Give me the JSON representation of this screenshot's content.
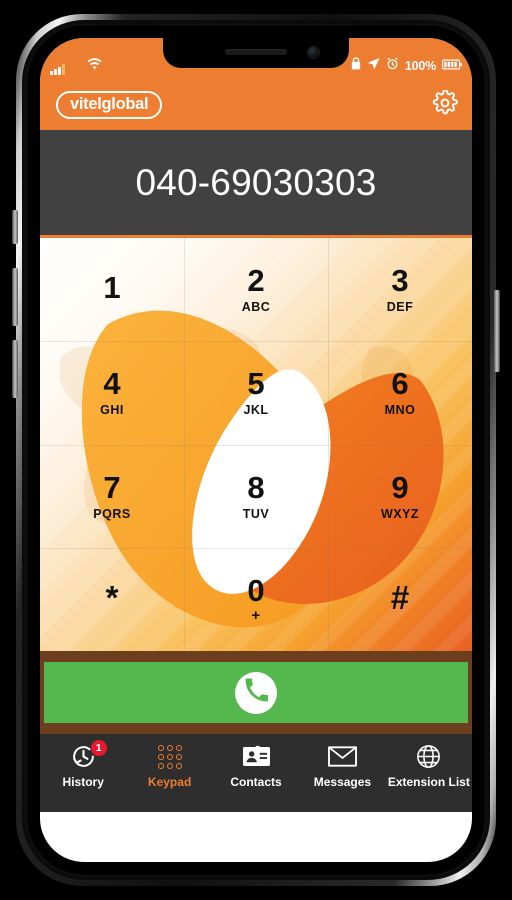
{
  "status_bar": {
    "signal_icon": "signal-bars-icon",
    "wifi_icon": "wifi-icon",
    "lock_icon": "lock-icon",
    "location_icon": "location-arrow-icon",
    "alarm_icon": "alarm-clock-icon",
    "battery_percent": "100%",
    "battery_icon": "battery-full-icon"
  },
  "app_bar": {
    "brand": "vitelglobal",
    "settings_icon": "gear-icon"
  },
  "display": {
    "number": "040-69030303"
  },
  "keypad": {
    "keys": [
      {
        "digit": "1",
        "letters": ""
      },
      {
        "digit": "2",
        "letters": "ABC"
      },
      {
        "digit": "3",
        "letters": "DEF"
      },
      {
        "digit": "4",
        "letters": "GHI"
      },
      {
        "digit": "5",
        "letters": "JKL"
      },
      {
        "digit": "6",
        "letters": "MNO"
      },
      {
        "digit": "7",
        "letters": "PQRS"
      },
      {
        "digit": "8",
        "letters": "TUV"
      },
      {
        "digit": "9",
        "letters": "WXYZ"
      },
      {
        "digit": "*",
        "letters": ""
      },
      {
        "digit": "0",
        "letters": "+"
      },
      {
        "digit": "#",
        "letters": ""
      }
    ]
  },
  "call_bar": {
    "icon": "phone-handset-icon",
    "label": ""
  },
  "bottom_nav": {
    "items": [
      {
        "label": "History",
        "icon": "history-clock-icon",
        "badge": "1",
        "active": false
      },
      {
        "label": "Keypad",
        "icon": "dialpad-icon",
        "badge": "",
        "active": true
      },
      {
        "label": "Contacts",
        "icon": "contact-card-icon",
        "badge": "",
        "active": false
      },
      {
        "label": "Messages",
        "icon": "envelope-icon",
        "badge": "",
        "active": false
      },
      {
        "label": "Extension List",
        "icon": "globe-icon",
        "badge": "",
        "active": false
      }
    ]
  },
  "colors": {
    "brand_orange": "#ED7D31",
    "display_bg": "#414141",
    "call_green": "#55B84E",
    "call_frame_brown": "#6B3F1E",
    "nav_bg": "#2E2E2E",
    "badge_red": "#E8192C"
  }
}
